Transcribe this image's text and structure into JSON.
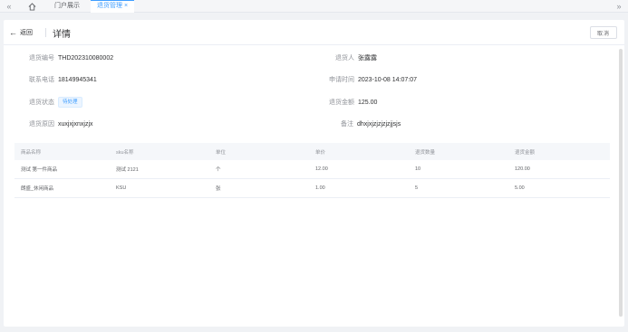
{
  "tabs": {
    "collapse_left": "«",
    "collapse_right": "»",
    "items": [
      {
        "label": "门户展示"
      },
      {
        "label": "退货管理",
        "close": "×"
      }
    ]
  },
  "header": {
    "back_label": "返回",
    "back_arrow": "←",
    "title": "详情",
    "cancel_label": "取消"
  },
  "detail": {
    "return_no": {
      "label": "退货编号",
      "value": "THD202310080002"
    },
    "returner": {
      "label": "退货人",
      "value": "张露露"
    },
    "phone": {
      "label": "联系电话",
      "value": "18149945341"
    },
    "apply_time": {
      "label": "申请时间",
      "value": "2023-10-08 14:07:07"
    },
    "status": {
      "label": "退货状态",
      "value": "待处理"
    },
    "amount": {
      "label": "退货金额",
      "value": "125.00"
    },
    "reason": {
      "label": "退货原因",
      "value": "xuxjxjxnxjzjx"
    },
    "remark": {
      "label": "备注",
      "value": "dhxjxjzjzjzjzjjsjs"
    }
  },
  "table": {
    "columns": [
      "商品名称",
      "sku名称",
      "单位",
      "单价",
      "退货数量",
      "退货金额"
    ],
    "rows": [
      [
        "测试 第一件商品",
        "测试 2121",
        "个",
        "12.00",
        "10",
        "120.00"
      ],
      [
        "朗盛_休闲商品",
        "KSU",
        "张",
        "1.00",
        "5",
        "5.00"
      ]
    ]
  },
  "colors": {
    "accent": "#409eff",
    "background": "#f0f2f5",
    "panel": "#ffffff",
    "label": "#909399",
    "text": "#303133"
  },
  "icons": {
    "home": "home-icon",
    "back": "arrow-left-icon"
  }
}
